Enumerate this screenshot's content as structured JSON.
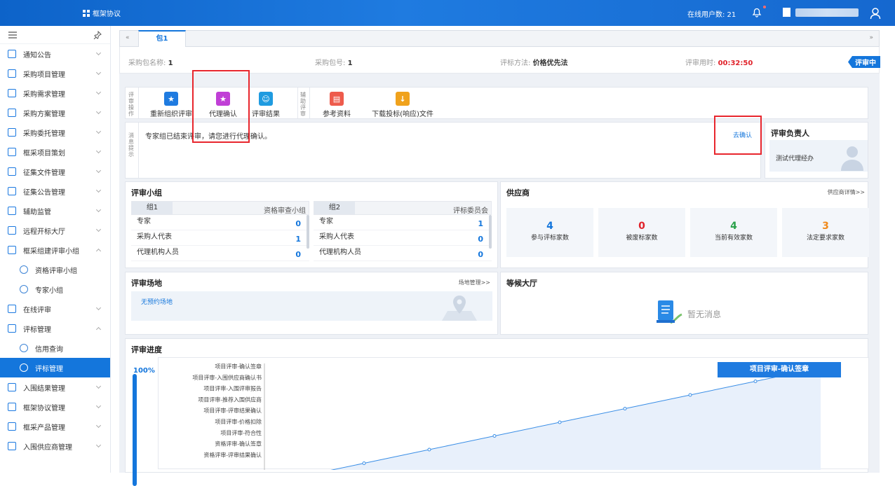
{
  "header": {
    "app_title": "框架协议",
    "online_label": "在线用户数: 21"
  },
  "sidebar": {
    "items": [
      {
        "label": "通知公告",
        "type": "top",
        "chev": "down"
      },
      {
        "label": "采购项目管理",
        "type": "top",
        "chev": "down"
      },
      {
        "label": "采购需求管理",
        "type": "top",
        "chev": "down"
      },
      {
        "label": "采购方案管理",
        "type": "top",
        "chev": "down"
      },
      {
        "label": "采购委托管理",
        "type": "top",
        "chev": "down"
      },
      {
        "label": "框采项目策划",
        "type": "top",
        "chev": "down"
      },
      {
        "label": "征集文件管理",
        "type": "top",
        "chev": "down"
      },
      {
        "label": "征集公告管理",
        "type": "top",
        "chev": "down"
      },
      {
        "label": "辅助监管",
        "type": "top",
        "chev": "down"
      },
      {
        "label": "远程开标大厅",
        "type": "top",
        "chev": "down"
      },
      {
        "label": "框采组建评审小组",
        "type": "top",
        "chev": "up"
      },
      {
        "label": "资格评审小组",
        "type": "sub",
        "chev": ""
      },
      {
        "label": "专家小组",
        "type": "sub",
        "chev": ""
      },
      {
        "label": "在线评审",
        "type": "top",
        "chev": "down"
      },
      {
        "label": "评标管理",
        "type": "top",
        "chev": "up"
      },
      {
        "label": "信用查询",
        "type": "sub",
        "chev": ""
      },
      {
        "label": "评标管理",
        "type": "sub",
        "chev": "",
        "active": true
      },
      {
        "label": "入围结果管理",
        "type": "top",
        "chev": "down"
      },
      {
        "label": "框架协议管理",
        "type": "top",
        "chev": "down"
      },
      {
        "label": "框采产品管理",
        "type": "top",
        "chev": "down"
      },
      {
        "label": "入围供应商管理",
        "type": "top",
        "chev": "down"
      }
    ]
  },
  "tab": {
    "label": "包1"
  },
  "info": {
    "pkg_name_label": "采购包名称:",
    "pkg_name": "1",
    "pkg_no_label": "采购包号:",
    "pkg_no": "1",
    "method_label": "评标方法:",
    "method": "价格优先法",
    "time_label": "评审用时:",
    "time": "00:32:50",
    "status": "评审中"
  },
  "toolbar": {
    "group1_label": "评审操作",
    "reorganize": "重新组织评审",
    "agent_confirm": "代理确认",
    "review_result": "评审结果",
    "group2_label": "辅助评审",
    "reference": "参考资料",
    "download": "下载投标(响应)文件"
  },
  "message": {
    "label": "消息提示",
    "text": "专家组已结束评审，请您进行代理确认。",
    "link": "去确认"
  },
  "owner": {
    "title": "评审负责人",
    "name": "测试代理经办"
  },
  "committee": {
    "title": "评审小组",
    "groups": [
      {
        "tab": "组1",
        "name": "资格审查小组",
        "rows": [
          {
            "label": "专家",
            "count": "0"
          },
          {
            "label": "采购人代表",
            "count": "1"
          },
          {
            "label": "代理机构人员",
            "count": "0"
          }
        ]
      },
      {
        "tab": "组2",
        "name": "评标委员会",
        "rows": [
          {
            "label": "专家",
            "count": "1"
          },
          {
            "label": "采购人代表",
            "count": "0"
          },
          {
            "label": "代理机构人员",
            "count": "0"
          }
        ]
      }
    ]
  },
  "suppliers": {
    "title": "供应商",
    "link": "供应商详情>>",
    "stats": [
      {
        "value": "4",
        "label": "参与评标家数",
        "color": "#1476dc"
      },
      {
        "value": "0",
        "label": "被废标家数",
        "color": "#e0222a"
      },
      {
        "value": "4",
        "label": "当前有效家数",
        "color": "#2aa14a"
      },
      {
        "value": "3",
        "label": "法定要求家数",
        "color": "#f08a1c"
      }
    ]
  },
  "venue": {
    "title": "评审场地",
    "link": "场地管理>>",
    "empty": "无预约场地"
  },
  "lobby": {
    "title": "等候大厅",
    "empty": "暂无消息"
  },
  "progress": {
    "title": "评审进度",
    "percent": "100%",
    "legend": "项目评审-确认签章"
  },
  "chart_data": {
    "type": "line",
    "y_categories": [
      "项目评审-确认签章",
      "项目评审-入围供应商确认书",
      "项目评审-入围评审报告",
      "项目评审-推荐入围供应商",
      "项目评审-评审结果确认",
      "项目评审-价格扣除",
      "项目评审-符合性",
      "资格评审-确认签章",
      "资格评审-评审结果确认"
    ],
    "series": [
      {
        "name": "项目评审-确认签章",
        "points": 9
      }
    ],
    "color": "#3a8ee6"
  }
}
